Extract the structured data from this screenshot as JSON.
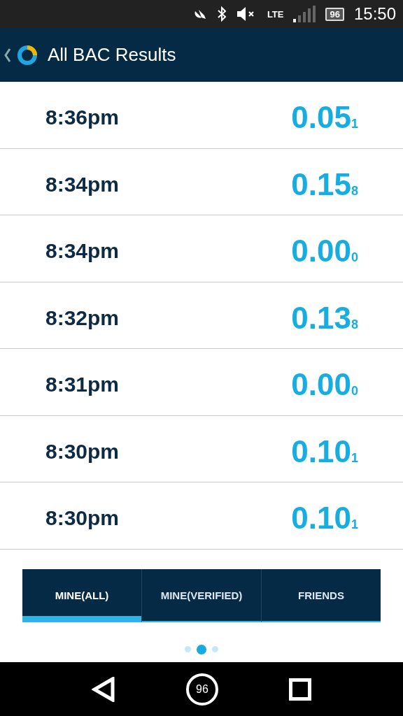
{
  "status_bar": {
    "network": "LTE",
    "battery": "96",
    "time": "15:50"
  },
  "header": {
    "title": "All BAC Results"
  },
  "results": [
    {
      "time": "8:36pm",
      "value": "0.05",
      "digit": "1"
    },
    {
      "time": "8:34pm",
      "value": "0.15",
      "digit": "8"
    },
    {
      "time": "8:34pm",
      "value": "0.00",
      "digit": "0"
    },
    {
      "time": "8:32pm",
      "value": "0.13",
      "digit": "8"
    },
    {
      "time": "8:31pm",
      "value": "0.00",
      "digit": "0"
    },
    {
      "time": "8:30pm",
      "value": "0.10",
      "digit": "1"
    },
    {
      "time": "8:30pm",
      "value": "0.10",
      "digit": "1"
    }
  ],
  "tabs": [
    {
      "label": "MINE(ALL)",
      "selected": true
    },
    {
      "label": "MINE(VERIFIED)",
      "selected": false
    },
    {
      "label": "FRIENDS",
      "selected": false
    }
  ],
  "pages": [
    {
      "selected": false
    },
    {
      "selected": true
    },
    {
      "selected": false
    }
  ],
  "nav_bar": {
    "home_badge": "96"
  }
}
